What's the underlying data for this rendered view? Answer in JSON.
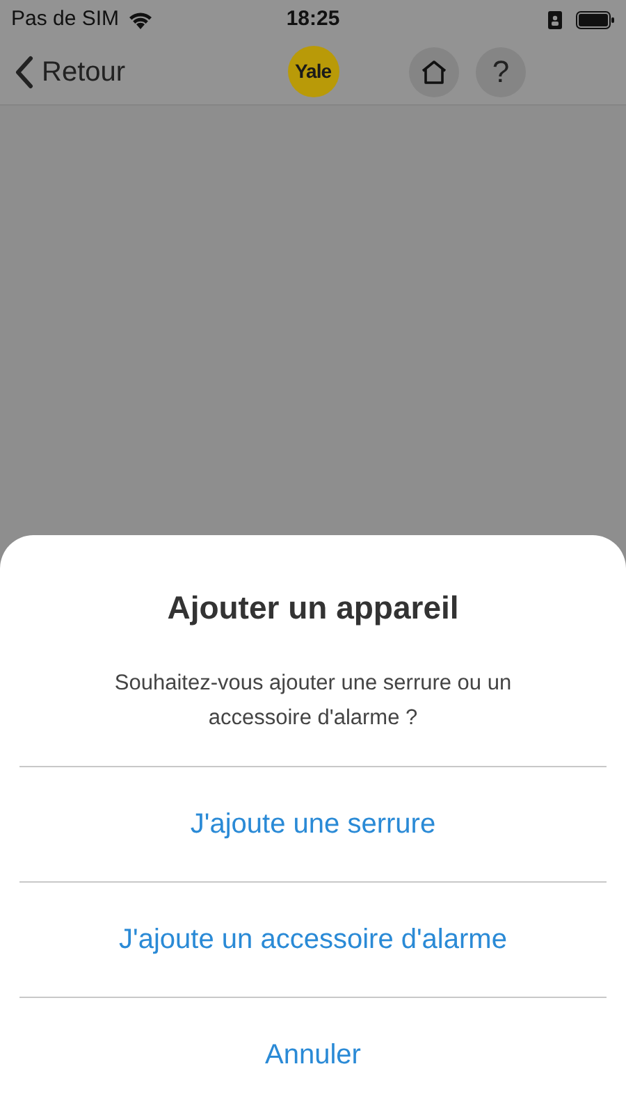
{
  "status_bar": {
    "carrier": "Pas de SIM",
    "time": "18:25"
  },
  "nav_bar": {
    "back_label": "Retour",
    "logo": "Yale",
    "help_label": "?"
  },
  "sheet": {
    "title": "Ajouter un appareil",
    "message": "Souhaitez-vous ajouter une serrure ou un accessoire d'alarme ?",
    "actions": [
      {
        "label": "J'ajoute une serrure"
      },
      {
        "label": "J'ajoute un accessoire d'alarme"
      },
      {
        "label": "Annuler"
      }
    ]
  }
}
